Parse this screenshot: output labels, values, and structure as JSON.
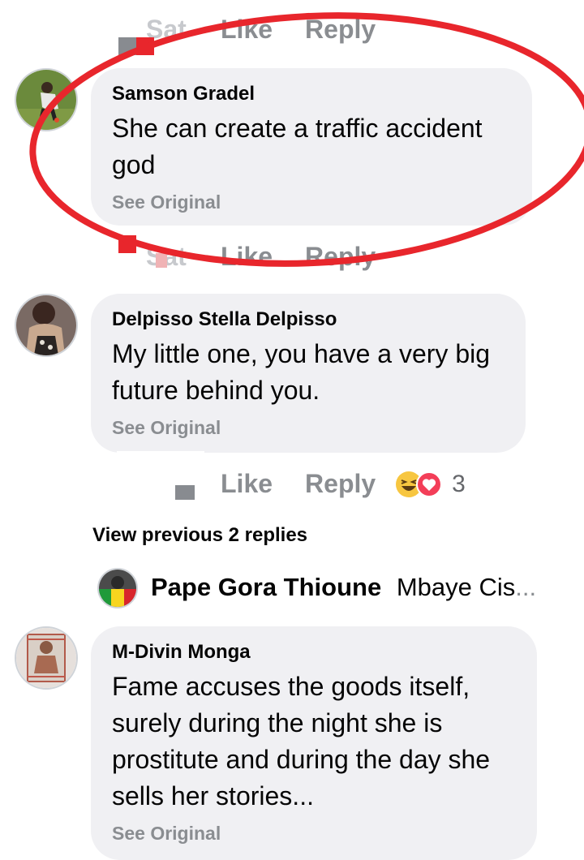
{
  "top_actions": {
    "time": "Sat",
    "like": "Like",
    "reply": "Reply"
  },
  "comments": [
    {
      "author": "Samson Gradel",
      "text": "She can create a traffic accident god",
      "see_original": "See Original",
      "actions": {
        "time": "Sat",
        "like": "Like",
        "reply": "Reply"
      }
    },
    {
      "author": "Delpisso Stella Delpisso",
      "text": "My little one, you have a very big future behind you.",
      "see_original": "See Original",
      "actions": {
        "like": "Like",
        "reply": "Reply",
        "reaction_count": "3"
      }
    },
    {
      "author": "M-Divin Monga",
      "text": "Fame accuses the goods itself, surely during the night she is prostitute and during the day she sells her stories...",
      "see_original": "See Original"
    }
  ],
  "view_previous": "View previous 2 replies",
  "reply_preview": {
    "author": "Pape Gora Thioune",
    "snippet": "Mbaye Cis",
    "ellipsis": "..."
  },
  "colors": {
    "bubble": "#f0f0f3",
    "meta": "#8a8d91",
    "annotation": "#e8262c"
  }
}
